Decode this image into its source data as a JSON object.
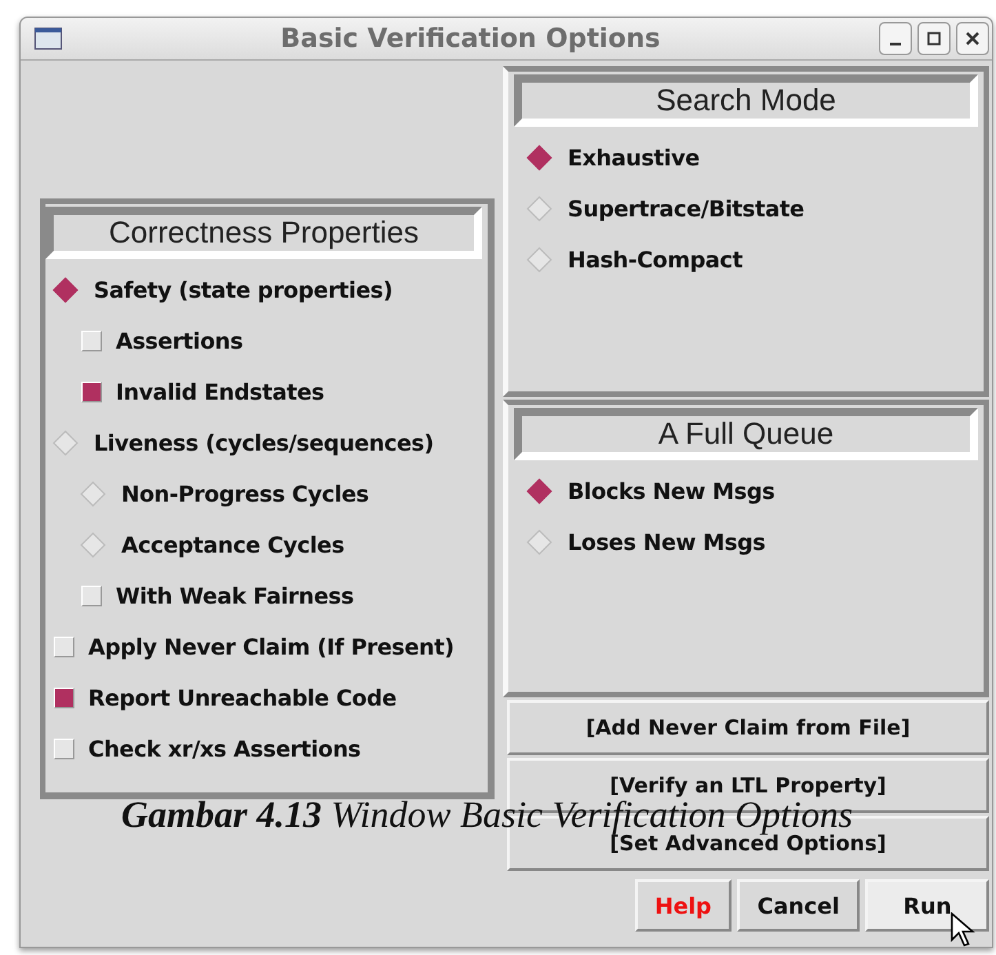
{
  "window": {
    "title": "Basic Verification Options"
  },
  "correctness": {
    "title": "Correctness Properties",
    "items": [
      {
        "kind": "radio",
        "label": "Safety (state properties)",
        "selected": true,
        "children": [
          {
            "kind": "checkbox",
            "label": "Assertions",
            "checked": false
          },
          {
            "kind": "checkbox",
            "label": "Invalid Endstates",
            "checked": true
          }
        ]
      },
      {
        "kind": "radio",
        "label": "Liveness (cycles/sequences)",
        "selected": false,
        "children": [
          {
            "kind": "radio",
            "label": "Non-Progress Cycles",
            "selected": false
          },
          {
            "kind": "radio",
            "label": "Acceptance Cycles",
            "selected": false
          },
          {
            "kind": "checkbox",
            "label": "With Weak Fairness",
            "checked": false
          }
        ]
      },
      {
        "kind": "checkbox",
        "label": "Apply Never Claim (If Present)",
        "checked": false
      },
      {
        "kind": "checkbox",
        "label": "Report Unreachable Code",
        "checked": true
      },
      {
        "kind": "checkbox",
        "label": "Check xr/xs Assertions",
        "checked": false
      }
    ]
  },
  "search_mode": {
    "title": "Search Mode",
    "options": [
      {
        "label": "Exhaustive",
        "selected": true
      },
      {
        "label": "Supertrace/Bitstate",
        "selected": false
      },
      {
        "label": "Hash-Compact",
        "selected": false
      }
    ]
  },
  "full_queue": {
    "title": "A Full Queue",
    "options": [
      {
        "label": "Blocks New Msgs",
        "selected": true
      },
      {
        "label": "Loses New Msgs",
        "selected": false
      }
    ]
  },
  "action_buttons": [
    "[Add Never Claim from File]",
    "[Verify an LTL Property]",
    "[Set Advanced Options]"
  ],
  "dialog_buttons": [
    {
      "label": "Help",
      "kind": "help",
      "hovered": false
    },
    {
      "label": "Cancel",
      "kind": "normal",
      "hovered": false
    },
    {
      "label": "Run",
      "kind": "normal",
      "hovered": true
    }
  ],
  "caption": "**Gambar 4.13** Window Basic Verification Options"
}
